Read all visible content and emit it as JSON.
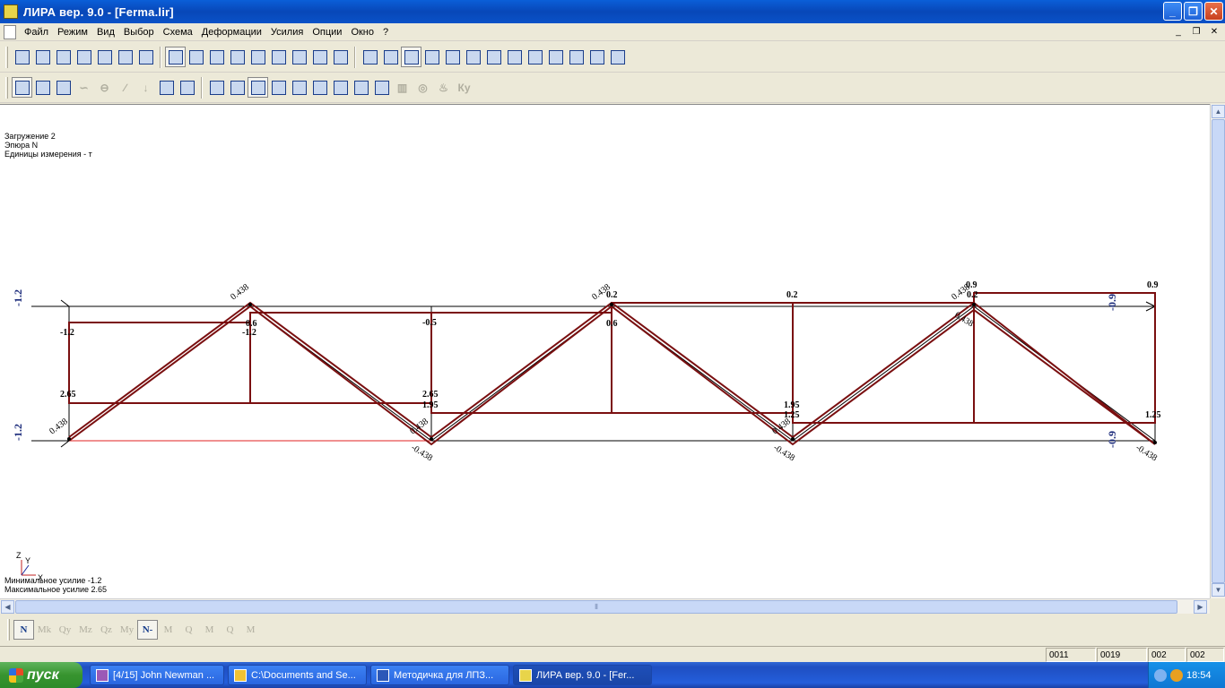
{
  "window": {
    "title": "ЛИРА  вер. 9.0 - [Ferma.lir]",
    "buttons": {
      "minimize": "_",
      "restore": "❐",
      "close": "✕"
    }
  },
  "menu": {
    "items": [
      "Файл",
      "Режим",
      "Вид",
      "Выбор",
      "Схема",
      "Деформации",
      "Усилия",
      "Опции",
      "Окно",
      "?"
    ],
    "mdi": {
      "minimize": "_",
      "restore": "❐",
      "close": "✕"
    }
  },
  "info": {
    "loading": "Загружение  2",
    "diagram": "Эпюра  N",
    "units": "Единицы измерения - т",
    "min_force": "Минимальное усилие  -1.2",
    "max_force": "Максимальное усилие  2.65"
  },
  "axes": {
    "z": "Z",
    "y": "Y",
    "x": "X"
  },
  "diagram_labels": {
    "left_top": "-1.2",
    "left_bottom": "-1.2",
    "right_top": "-0.9",
    "right_bottom": "-0.9",
    "v1_top": "-1.2",
    "v1_bottom": "2.65",
    "n1_top": "0.438",
    "n1_bot": "0.438",
    "n2_top": "0.438",
    "n2_inner": "0.6",
    "n2_below": "-1.2",
    "n3_top": "-0.5",
    "n3_mid1": "2.65",
    "n3_mid2": "1.95",
    "n3_bot": "-0.438",
    "n3_bot2": "0.438",
    "n4_top": "0.438",
    "n4_top2": "0.2",
    "n4_inner": "0.6",
    "n5_top": "0.2",
    "n5_mid1": "1.95",
    "n5_mid2": "1.25",
    "n5_bot": "-0.438",
    "n5_bot2": "0.438",
    "n6_top": "0.438",
    "n6_top2": "0.2",
    "n6_top3": "0.9",
    "n6_below": "0.438",
    "n7_top": "0.9",
    "n7_mid": "1.25",
    "n7_bot": "-0.438"
  },
  "force_toolbar": [
    "N",
    "Mk",
    "Qy",
    "Mz",
    "Qz",
    "My",
    "N-",
    "M",
    "Q",
    "M",
    "Q",
    "M"
  ],
  "status": [
    "0011",
    "0019",
    "002",
    "002"
  ],
  "taskbar": {
    "start": "пуск",
    "tasks": [
      "[4/15] John Newman ...",
      "C:\\Documents and Se...",
      "Методичка для ЛПЗ...",
      "ЛИРА  вер. 9.0 - [Fer..."
    ],
    "clock": "18:54"
  },
  "colors": {
    "diagram": "#7a0f10",
    "scheme": "#000000",
    "label_blue": "#1a2a7a"
  }
}
